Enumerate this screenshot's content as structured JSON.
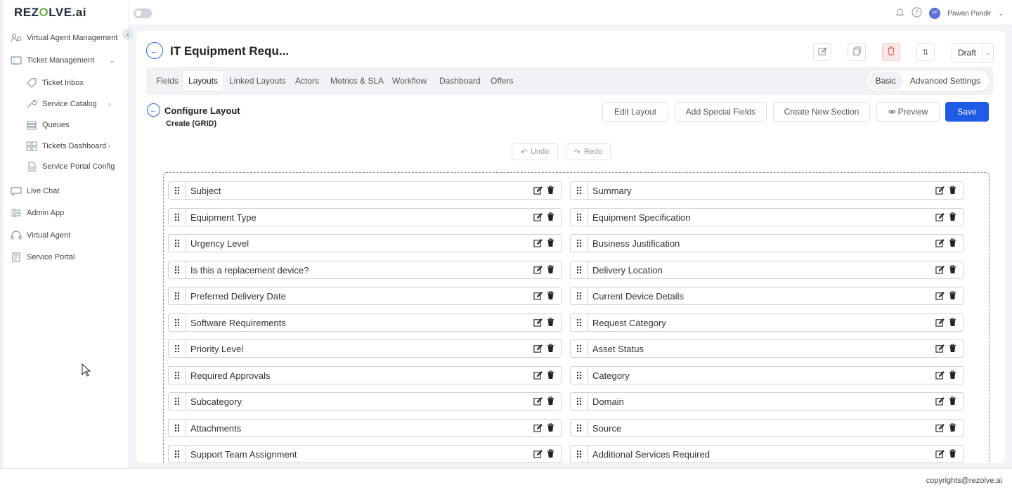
{
  "app": {
    "logo_text": "REZOLVE.ai",
    "brand_color": "#1e5ae6",
    "accent_color": "#6ab04c"
  },
  "sidebar": {
    "items": [
      {
        "label": "Virtual Agent Management",
        "icon": "users-gear-icon"
      },
      {
        "label": "Ticket Management",
        "icon": "ticket-icon",
        "expanded": true
      },
      {
        "label": "Ticket Inbox",
        "icon": "tag-icon",
        "sub": true
      },
      {
        "label": "Service Catalog",
        "icon": "wrench-icon",
        "sub": true
      },
      {
        "label": "Queues",
        "icon": "queue-list-icon",
        "sub": true
      },
      {
        "label": "Tickets Dashboard",
        "icon": "dashboard-grid-icon",
        "sub": true
      },
      {
        "label": "Service Portal Config",
        "icon": "document-settings-icon",
        "sub": true
      },
      {
        "label": "Live Chat",
        "icon": "chat-icon"
      },
      {
        "label": "Admin App",
        "icon": "sliders-icon"
      },
      {
        "label": "Virtual Agent",
        "icon": "headset-icon"
      },
      {
        "label": "Service Portal",
        "icon": "portal-doc-icon"
      }
    ]
  },
  "topbar": {
    "user_initials": "PP",
    "user_name": "Pawan Pundir"
  },
  "header": {
    "title": "IT Equipment Requ...",
    "status": "Draft"
  },
  "tabs": [
    {
      "label": "Fields"
    },
    {
      "label": "Layouts",
      "active": true
    },
    {
      "label": "Linked Layouts"
    },
    {
      "label": "Actors"
    },
    {
      "label": "Metrics & SLA"
    },
    {
      "label": "Workflow"
    },
    {
      "label": "Dashboard"
    },
    {
      "label": "Offers"
    }
  ],
  "settings_toggle": {
    "basic": "Basic",
    "advanced": "Advanced Settings",
    "selected": "Basic"
  },
  "configure": {
    "title": "Configure Layout",
    "subtitle": "Create (GRID)",
    "edit_layout": "Edit Layout",
    "add_special_fields": "Add Special Fields",
    "create_new_section": "Create New Section",
    "preview": "Preview",
    "save": "Save",
    "undo": "Undo",
    "redo": "Redo"
  },
  "grid": {
    "left": [
      "Subject",
      "Equipment Type",
      "Urgency Level",
      "Is this a replacement device?",
      "Preferred Delivery Date",
      "Software Requirements",
      "Priority Level",
      "Required Approvals",
      "Subcategory",
      "Attachments",
      "Support Team Assignment"
    ],
    "right": [
      "Summary",
      "Equipment Specification",
      "Business Justification",
      "Delivery Location",
      "Current Device Details",
      "Request Category",
      "Asset Status",
      "Category",
      "Domain",
      "Source",
      "Additional Services Required"
    ]
  },
  "footer": {
    "copyright": "copyrights@rezolve.ai"
  }
}
